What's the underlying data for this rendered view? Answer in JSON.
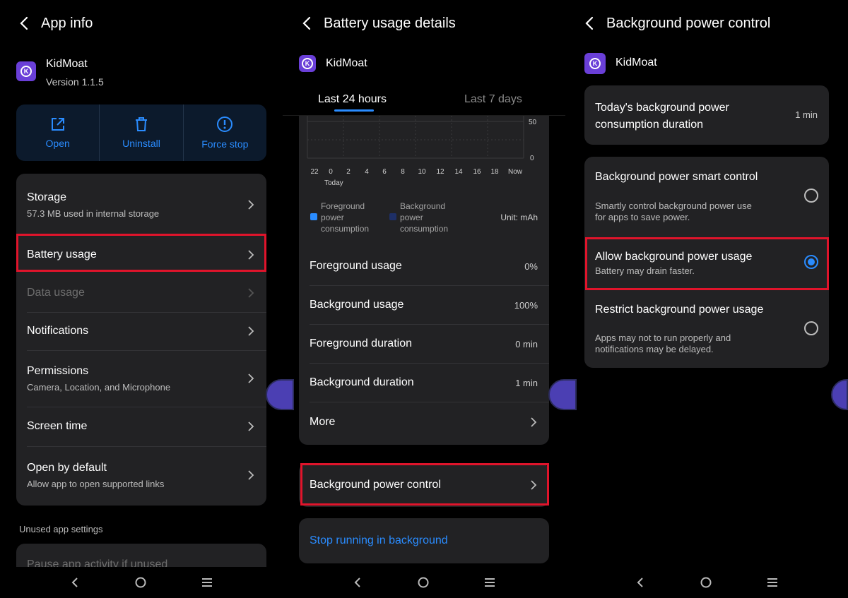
{
  "panel1": {
    "title": "App info",
    "app": {
      "name": "KidMoat",
      "version": "Version 1.1.5"
    },
    "actions": [
      {
        "label": "Open",
        "icon": "open-external-icon"
      },
      {
        "label": "Uninstall",
        "icon": "trash-icon"
      },
      {
        "label": "Force stop",
        "icon": "alert-circle-icon"
      }
    ],
    "rows": {
      "storage": {
        "label": "Storage",
        "sub": "57.3 MB used in internal storage"
      },
      "battery": {
        "label": "Battery usage"
      },
      "data": {
        "label": "Data usage"
      },
      "notifications": {
        "label": "Notifications"
      },
      "permissions": {
        "label": "Permissions",
        "sub": "Camera, Location, and Microphone"
      },
      "screen_time": {
        "label": "Screen time"
      },
      "open_default": {
        "label": "Open by default",
        "sub": "Allow app to open supported links"
      }
    },
    "unused_header": "Unused app settings",
    "pause_label": "Pause app activity if unused"
  },
  "panel2": {
    "title": "Battery usage details",
    "app": {
      "name": "KidMoat"
    },
    "tabs": [
      "Last 24 hours",
      "Last 7 days"
    ],
    "chart": {
      "y_ticks": [
        "50",
        "0"
      ],
      "x_ticks": [
        "22",
        "0",
        "2",
        "4",
        "6",
        "8",
        "10",
        "12",
        "14",
        "16",
        "18",
        "Now"
      ],
      "x_sub": "Today"
    },
    "legend": {
      "fg": "Foreground power consumption",
      "bg": "Background power consumption",
      "unit": "Unit: mAh",
      "fg_color": "#2a8cff",
      "bg_color": "#1e2f66"
    },
    "stats": [
      {
        "label": "Foreground usage",
        "value": "0%"
      },
      {
        "label": "Background usage",
        "value": "100%"
      },
      {
        "label": "Foreground duration",
        "value": "0 min"
      },
      {
        "label": "Background duration",
        "value": "1 min"
      }
    ],
    "more": "More",
    "bg_power_control": "Background power control",
    "stop_running": "Stop running in background"
  },
  "panel3": {
    "title": "Background power control",
    "app": {
      "name": "KidMoat"
    },
    "today": {
      "label": "Today's background power consumption duration",
      "value": "1 min"
    },
    "options": [
      {
        "label": "Background power smart control",
        "sub": "Smartly control background power use for apps to save power.",
        "selected": false
      },
      {
        "label": "Allow background power usage",
        "sub": "Battery may drain faster.",
        "selected": true
      },
      {
        "label": "Restrict background power usage",
        "sub": "Apps may not to run properly and notifications may be delayed.",
        "selected": false
      }
    ]
  },
  "colors": {
    "accent": "#2a8cff",
    "highlight": "#e0142b",
    "card": "#222224"
  }
}
